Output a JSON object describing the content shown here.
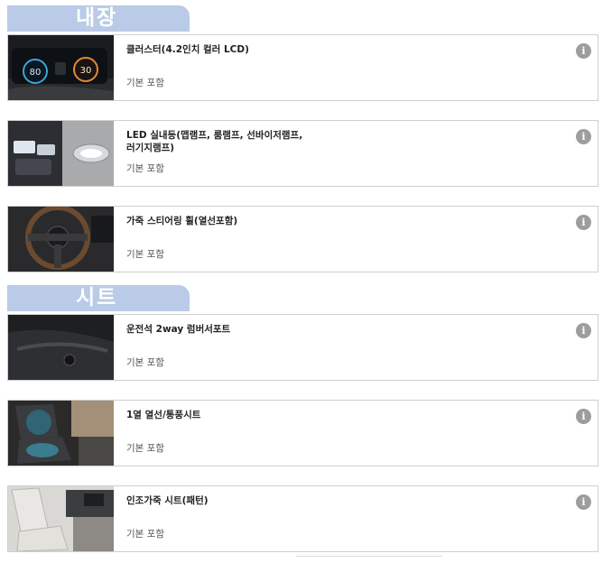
{
  "sections": [
    {
      "label": "내장"
    },
    {
      "label": "시트"
    }
  ],
  "items": [
    {
      "title": "클러스터(4.2인치 컬러 LCD)",
      "status": "기본 포함",
      "thumb_icon": "cluster-display-photo",
      "gauge_left": "80",
      "gauge_right": "30"
    },
    {
      "title": "LED 실내등(맵램프, 룸램프, 선바이저램프, 러기지램프)",
      "status": "기본 포함",
      "thumb_icon": "led-interior-light-photo"
    },
    {
      "title": "가죽 스티어링 휠(열선포함)",
      "status": "기본 포함",
      "thumb_icon": "steering-wheel-photo"
    },
    {
      "title": "운전석 2way 럼버서포트",
      "status": "기본 포함",
      "thumb_icon": "lumbar-support-photo"
    },
    {
      "title": "1열 열선/통풍시트",
      "status": "기본 포함",
      "thumb_icon": "heated-ventilated-seat-photo"
    },
    {
      "title": "인조가죽 시트(패턴)",
      "status": "기본 포함",
      "thumb_icon": "artificial-leather-seat-photo"
    }
  ],
  "info_glyph": "i",
  "colors": {
    "tab": "#b9cbe7",
    "border": "#cfcfcf",
    "info": "#9d9d9d"
  }
}
